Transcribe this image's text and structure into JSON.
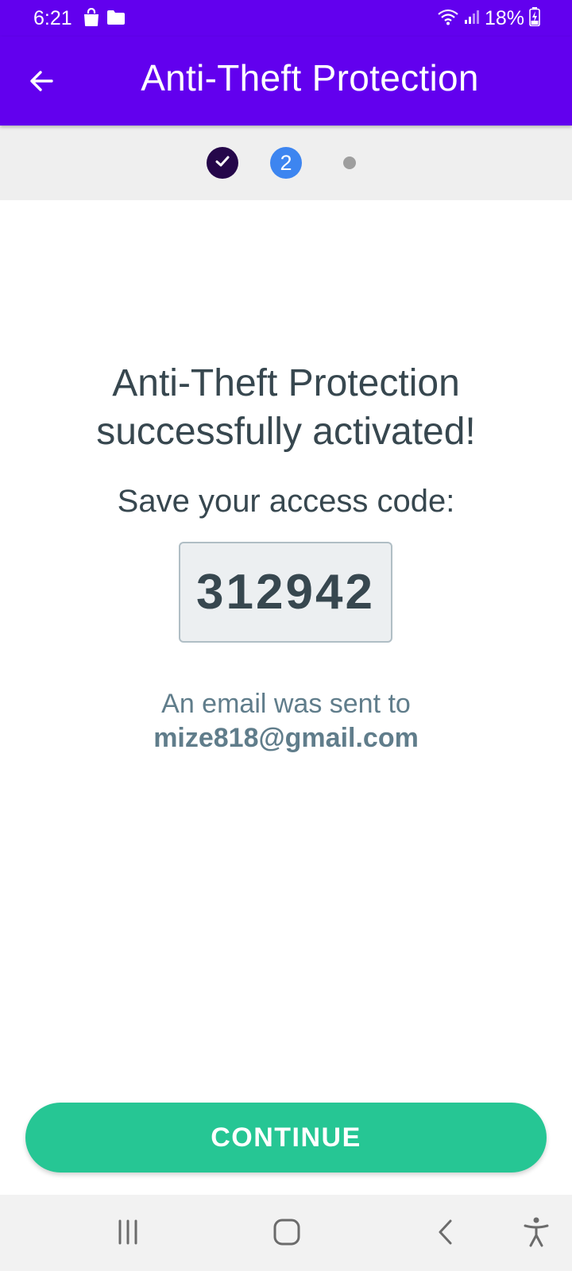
{
  "status_bar": {
    "time": "6:21",
    "battery": "18%",
    "icons": [
      "shopping-bag-icon",
      "folder-icon",
      "wifi-icon",
      "signal-icon",
      "battery-charging-icon"
    ]
  },
  "app_bar": {
    "title": "Anti-Theft Protection",
    "back_icon": "arrow-left-icon",
    "color": "#6200EE"
  },
  "stepper": {
    "steps": [
      {
        "state": "completed",
        "icon": "check-icon"
      },
      {
        "state": "active",
        "label": "2"
      },
      {
        "state": "pending"
      }
    ]
  },
  "content": {
    "headline_line1": "Anti-Theft Protection",
    "headline_line2": "successfully activated!",
    "save_prompt": "Save your access code:",
    "access_code": "312942",
    "email_prefix": "An email was sent to",
    "email": "mize818@gmail.com"
  },
  "continue_button": {
    "label": "CONTINUE",
    "color": "#26C694"
  },
  "nav_bar": {
    "items": [
      "recent-apps-icon",
      "home-icon",
      "back-icon",
      "accessibility-icon"
    ]
  }
}
